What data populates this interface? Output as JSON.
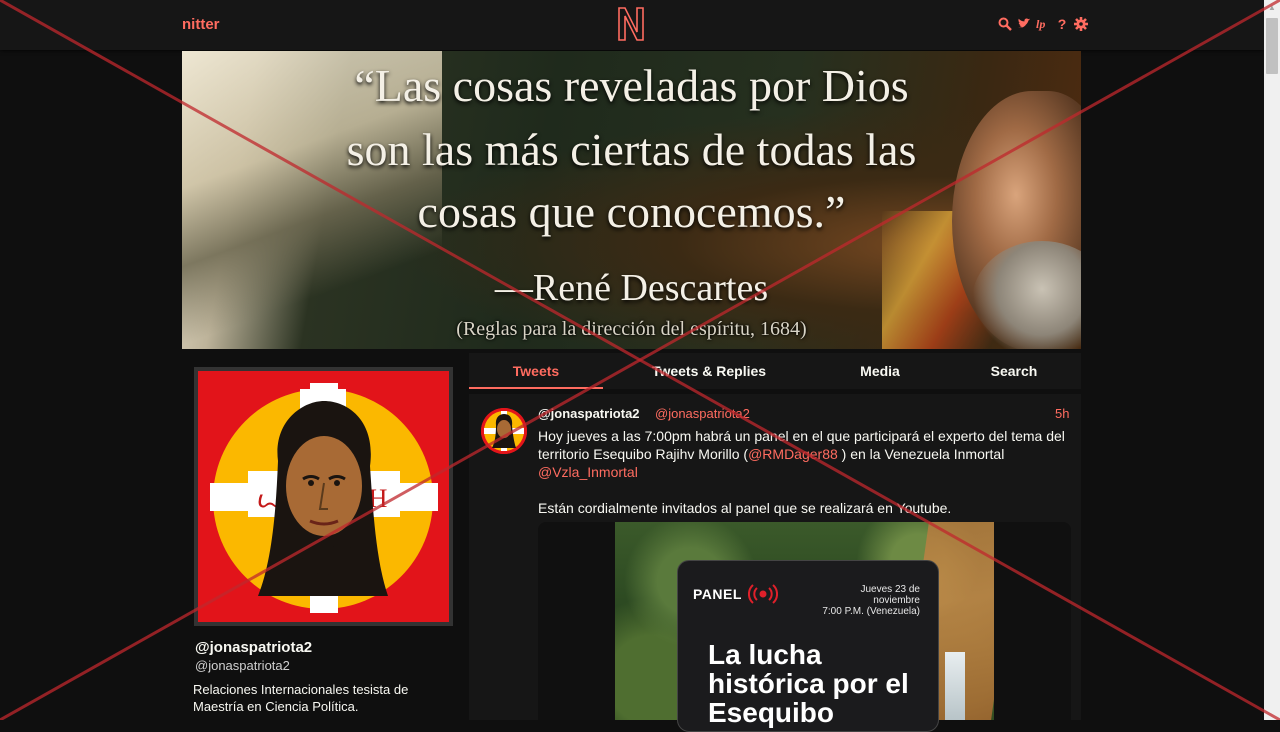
{
  "navbar": {
    "brand": "nitter",
    "logo_letter": "N",
    "icons": [
      "search-icon",
      "bird-icon",
      "lp-icon",
      "question-icon",
      "gear-icon"
    ]
  },
  "banner": {
    "quote_line1": "“Las cosas reveladas por Dios",
    "quote_line2": "son las más ciertas de todas las",
    "quote_line3": "cosas que conocemos.”",
    "author": "—René Descartes",
    "source": "(Reglas para la dirección del espíritu, 1684)"
  },
  "profile": {
    "fullname": "@jonaspatriota2",
    "username": "@jonaspatriota2",
    "bio": "Relaciones Internacionales tesista de Maestría en Ciencia Política.",
    "avatar_letters": [
      "Ω",
      "ꙍ",
      "Н"
    ]
  },
  "tabs": [
    {
      "label": "Tweets",
      "active": true
    },
    {
      "label": "Tweets & Replies",
      "active": false
    },
    {
      "label": "Media",
      "active": false
    },
    {
      "label": "Search",
      "active": false
    }
  ],
  "tweet": {
    "fullname": "@jonaspatriota2",
    "username": "@jonaspatriota2",
    "date": "5h",
    "text_part1": "Hoy jueves a las 7:00pm habrá un panel en el que participará el experto del tema del territorio Esequibo Rajihv Morillo (",
    "mention1": "@RMDager88",
    "text_part2": " ) en la Venezuela Inmortal ",
    "mention2": "@Vzla_Inmortal",
    "text_part3": "Están cordialmente invitados al panel que se realizará en Youtube.",
    "attachment": {
      "panel_label": "PANEL",
      "date_line1": "Jueves 23 de",
      "date_line2": "noviembre",
      "date_line3": "7:00 P.M. (Venezuela)",
      "title": "La lucha histórica por el Esequibo"
    }
  },
  "colors": {
    "accent": "#ff6c60",
    "background": "#0f0f0f",
    "panel_bg": "#161616",
    "text": "#f8f8f2",
    "overlay_x": "#c0282d"
  }
}
